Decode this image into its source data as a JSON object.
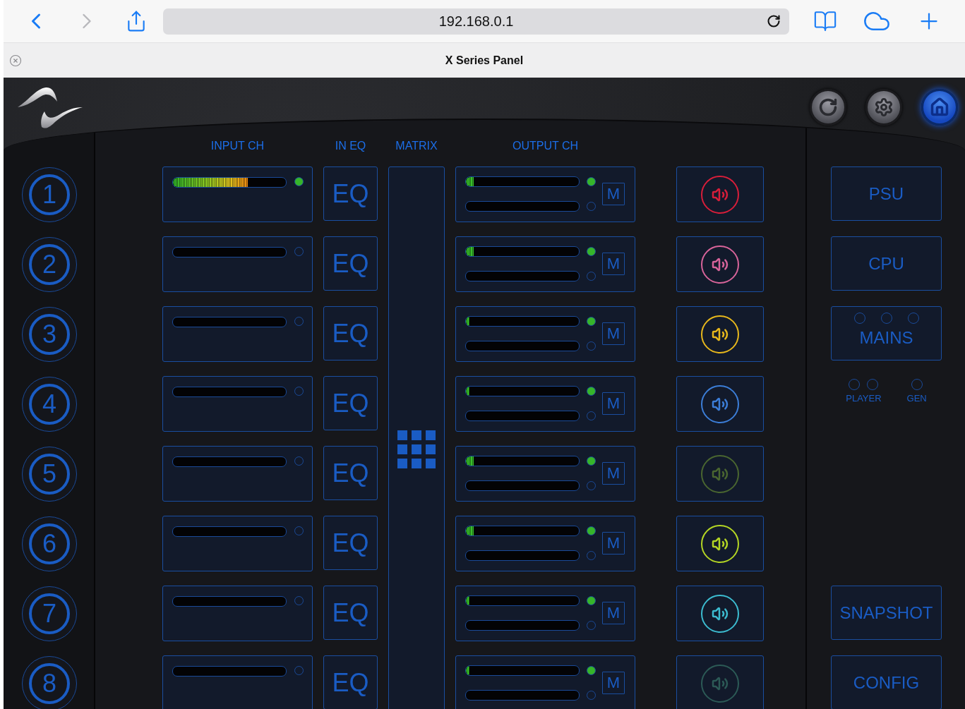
{
  "browser": {
    "back_enabled": true,
    "forward_enabled": false,
    "url": "192.168.0.1",
    "tab_title": "X Series Panel"
  },
  "header_buttons": [
    {
      "kind": "reload",
      "selected": false
    },
    {
      "kind": "settings",
      "selected": false
    },
    {
      "kind": "home",
      "selected": true
    }
  ],
  "column_headers": [
    "INPUT CH",
    "IN EQ",
    "MATRIX",
    "OUTPUT CH"
  ],
  "channels": [
    {
      "number": "1",
      "input": {
        "level": 0.66,
        "signal": true
      },
      "eq": "EQ",
      "outputs": [
        {
          "level": 0.07,
          "signal": true
        },
        {
          "level": 0,
          "signal": false
        }
      ],
      "mute": "M",
      "color": "#d81e3a"
    },
    {
      "number": "2",
      "input": {
        "level": 0,
        "signal": false
      },
      "eq": "EQ",
      "outputs": [
        {
          "level": 0.07,
          "signal": true
        },
        {
          "level": 0,
          "signal": false
        }
      ],
      "mute": "M",
      "color": "#d8649a"
    },
    {
      "number": "3",
      "input": {
        "level": 0,
        "signal": false
      },
      "eq": "EQ",
      "outputs": [
        {
          "level": 0.03,
          "signal": true
        },
        {
          "level": 0,
          "signal": false
        }
      ],
      "mute": "M",
      "color": "#e8b81c"
    },
    {
      "number": "4",
      "input": {
        "level": 0,
        "signal": false
      },
      "eq": "EQ",
      "outputs": [
        {
          "level": 0.03,
          "signal": true
        },
        {
          "level": 0,
          "signal": false
        }
      ],
      "mute": "M",
      "color": "#3c7ed8"
    },
    {
      "number": "5",
      "input": {
        "level": 0,
        "signal": false
      },
      "eq": "EQ",
      "outputs": [
        {
          "level": 0.07,
          "signal": true
        },
        {
          "level": 0,
          "signal": false
        }
      ],
      "mute": "M",
      "color": "#4a6630"
    },
    {
      "number": "6",
      "input": {
        "level": 0,
        "signal": false
      },
      "eq": "EQ",
      "outputs": [
        {
          "level": 0.07,
          "signal": true
        },
        {
          "level": 0,
          "signal": false
        }
      ],
      "mute": "M",
      "color": "#b4d624"
    },
    {
      "number": "7",
      "input": {
        "level": 0,
        "signal": false
      },
      "eq": "EQ",
      "outputs": [
        {
          "level": 0.03,
          "signal": true
        },
        {
          "level": 0,
          "signal": false
        }
      ],
      "mute": "M",
      "color": "#3cbcd0"
    },
    {
      "number": "8",
      "input": {
        "level": 0,
        "signal": false
      },
      "eq": "EQ",
      "outputs": [
        {
          "level": 0.03,
          "signal": true
        },
        {
          "level": 0,
          "signal": false
        }
      ],
      "mute": "M",
      "color": "#2c5a56"
    }
  ],
  "status_buttons": [
    {
      "label": "PSU"
    },
    {
      "label": "CPU"
    },
    {
      "label": "MAINS",
      "leds": [
        false,
        false,
        false
      ]
    }
  ],
  "indicators": [
    {
      "label": "PLAYER",
      "leds": [
        false,
        false
      ]
    },
    {
      "label": "GEN",
      "leds": [
        false
      ]
    }
  ],
  "bottom_buttons": [
    "SNAPSHOT",
    "CONFIG"
  ]
}
